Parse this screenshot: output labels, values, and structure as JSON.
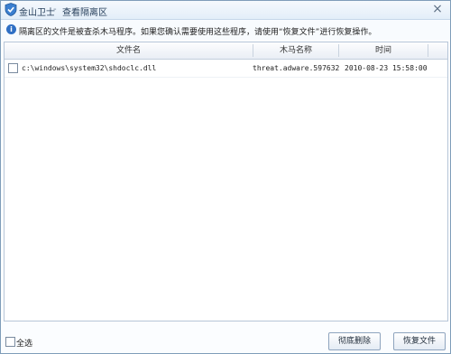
{
  "window": {
    "app_name": "金山卫士",
    "separator": "-",
    "page_title": "查看隔离区",
    "close_symbol": "×"
  },
  "info": {
    "icon": "info-icon",
    "text": "隔离区的文件是被查杀木马程序。如果您确认需要使用这些程序，请使用“恢复文件”进行恢复操作。"
  },
  "table": {
    "columns": [
      "文件名",
      "木马名称",
      "时间"
    ],
    "rows": [
      {
        "checked": false,
        "file": "c:\\windows\\system32\\shdoclc.dll",
        "trojan": "threat.adware.597632",
        "time": "2010-08-23 15:58:00"
      }
    ]
  },
  "footer": {
    "select_all_label": "全选",
    "delete_button": "彻底删除",
    "restore_button": "恢复文件"
  },
  "colors": {
    "accent": "#2f6fc4",
    "border": "#7f9db9"
  }
}
